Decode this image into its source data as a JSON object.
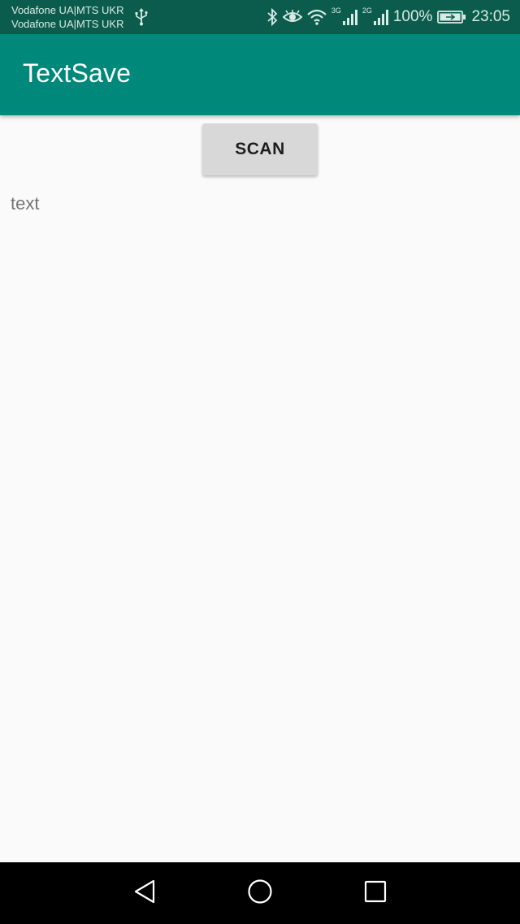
{
  "status_bar": {
    "carrier_1": "Vodafone UA|MTS UKR",
    "carrier_2": "Vodafone UA|MTS UKR",
    "network_1": "3G",
    "network_2": "2G",
    "battery_percent": "100%",
    "time": "23:05",
    "icons": [
      "usb-icon",
      "bluetooth-icon",
      "eye-icon",
      "wifi-icon",
      "signal-icon",
      "battery-icon"
    ]
  },
  "app_bar": {
    "title": "TextSave"
  },
  "main": {
    "scan_label": "SCAN",
    "output_text": "text"
  },
  "nav_bar": {
    "icons": [
      "back-icon",
      "home-icon",
      "recents-icon"
    ]
  },
  "colors": {
    "status_bar": "#0c5c4e",
    "app_bar": "#00897b",
    "background": "#fafafa",
    "button": "#d8d8d8",
    "nav_bar": "#000000"
  }
}
